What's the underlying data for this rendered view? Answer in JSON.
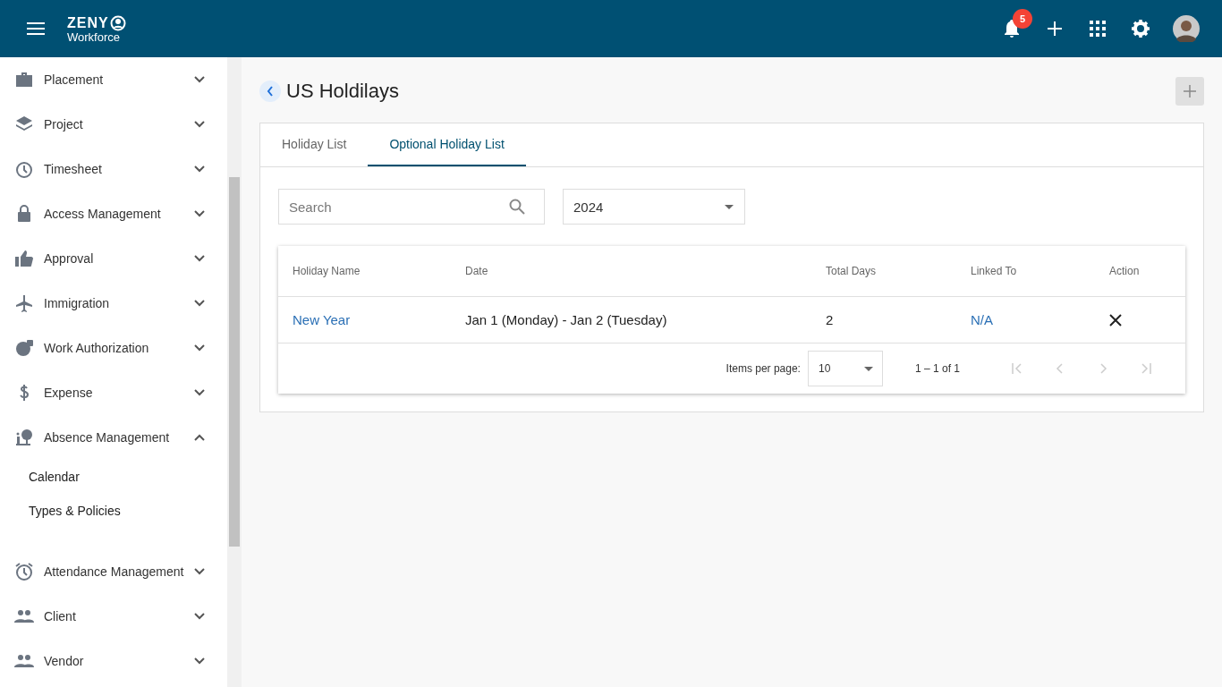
{
  "header": {
    "logo_top": "ZENY",
    "logo_bottom": "Workforce",
    "notifications": "5"
  },
  "sidebar": {
    "items": [
      {
        "label": "Placement",
        "expanded": false
      },
      {
        "label": "Project",
        "expanded": false
      },
      {
        "label": "Timesheet",
        "expanded": false
      },
      {
        "label": "Access Management",
        "expanded": false
      },
      {
        "label": "Approval",
        "expanded": false
      },
      {
        "label": "Immigration",
        "expanded": false
      },
      {
        "label": "Work Authorization",
        "expanded": false
      },
      {
        "label": "Expense",
        "expanded": false
      },
      {
        "label": "Absence Management",
        "expanded": true,
        "children": [
          {
            "label": "Calendar"
          },
          {
            "label": "Types & Policies"
          }
        ]
      },
      {
        "label": "Attendance Management",
        "expanded": false
      },
      {
        "label": "Client",
        "expanded": false
      },
      {
        "label": "Vendor",
        "expanded": false
      }
    ]
  },
  "page": {
    "title": "US Holdilays"
  },
  "tabs": [
    {
      "label": "Holiday List",
      "selected": false
    },
    {
      "label": "Optional Holiday List",
      "selected": true
    }
  ],
  "search": {
    "placeholder": "Search"
  },
  "year_select": {
    "value": "2024"
  },
  "table": {
    "columns": [
      "Holiday Name",
      "Date",
      "Total Days",
      "Linked To",
      "Action"
    ],
    "rows": [
      {
        "name": "New Year",
        "date": "Jan 1 (Monday) - Jan 2 (Tuesday)",
        "total_days": "2",
        "linked_to": "N/A"
      }
    ]
  },
  "paginator": {
    "label": "Items per page:",
    "page_size": "10",
    "range": "1 – 1 of 1"
  }
}
